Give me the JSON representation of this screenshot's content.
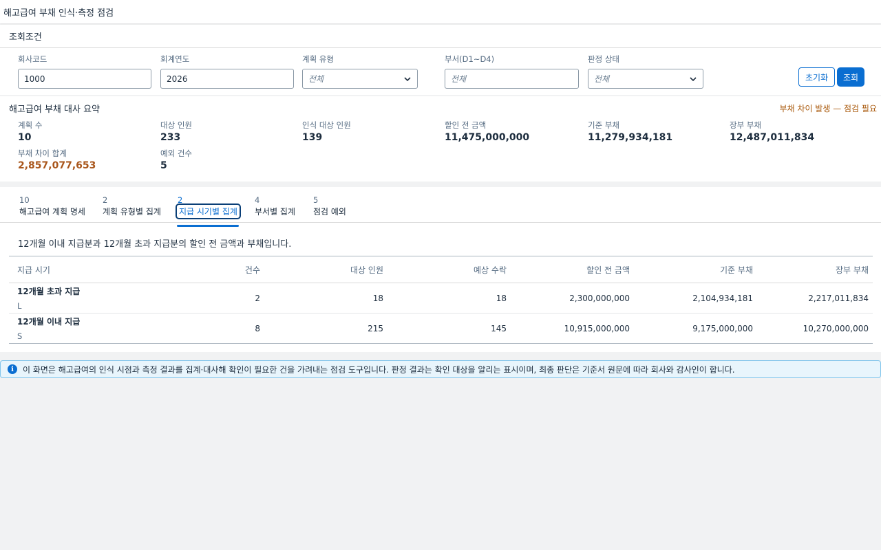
{
  "app": {
    "title": "해고급여 부채 인식·측정 점검"
  },
  "filters": {
    "header": "조회조건",
    "company_code": {
      "label": "회사코드",
      "value": "1000"
    },
    "fiscal_year": {
      "label": "회계연도",
      "value": "2026"
    },
    "plan_type": {
      "label": "계획 유형",
      "value": "전체"
    },
    "department": {
      "label": "부서(D1~D4)",
      "placeholder": "전체"
    },
    "status": {
      "label": "판정 상태",
      "value": "전체"
    },
    "reset_label": "초기화",
    "search_label": "조회"
  },
  "summary": {
    "header": "해고급여 부채 대사 요약",
    "warning": "부채 차이 발생 — 점검 필요",
    "kpis": [
      {
        "label": "계획 수",
        "value": "10"
      },
      {
        "label": "대상 인원",
        "value": "233"
      },
      {
        "label": "인식 대상 인원",
        "value": "139"
      },
      {
        "label": "할인 전 금액",
        "value": "11,475,000,000"
      },
      {
        "label": "기준 부채",
        "value": "11,279,934,181"
      },
      {
        "label": "장부 부채",
        "value": "12,487,011,834"
      },
      {
        "label": "부채 차이 합계",
        "value": "2,857,077,653"
      },
      {
        "label": "예외 건수",
        "value": "5"
      }
    ],
    "accent_color": "#a9561b"
  },
  "tabs": [
    {
      "count": "10",
      "label": "해고급여 계획 명세"
    },
    {
      "count": "2",
      "label": "계획 유형별 집계"
    },
    {
      "count": "2",
      "label": "지급 시기별 집계"
    },
    {
      "count": "4",
      "label": "부서별 집계"
    },
    {
      "count": "5",
      "label": "점검 예외"
    }
  ],
  "active_tab": "지급 시기별 집계",
  "main": {
    "description": "12개월 이내 지급분과 12개월 초과 지급분의 할인 전 금액과 부채입니다.",
    "columns": [
      "지급 시기",
      "건수",
      "대상 인원",
      "예상 수락",
      "할인 전 금액",
      "기준 부채",
      "장부 부채"
    ],
    "rows": [
      {
        "name": "12개월 초과 지급",
        "code": "L",
        "count": "2",
        "headcount": "18",
        "expected": "18",
        "gross": "2,300,000,000",
        "base": "2,104,934,181",
        "book": "2,217,011,834"
      },
      {
        "name": "12개월 이내 지급",
        "code": "S",
        "count": "8",
        "headcount": "215",
        "expected": "145",
        "gross": "10,915,000,000",
        "base": "9,175,000,000",
        "book": "10,270,000,000"
      }
    ]
  },
  "notice": {
    "icon": "info-icon",
    "text": "이 화면은 해고급여의 인식 시점과 측정 결과를 집계·대사해 확인이 필요한 건을 가려내는 점검 도구입니다. 판정 결과는 확인 대상을 알리는 표시이며, 최종 판단은 기준서 원문에 따라 회사와 감사인이 합니다."
  }
}
